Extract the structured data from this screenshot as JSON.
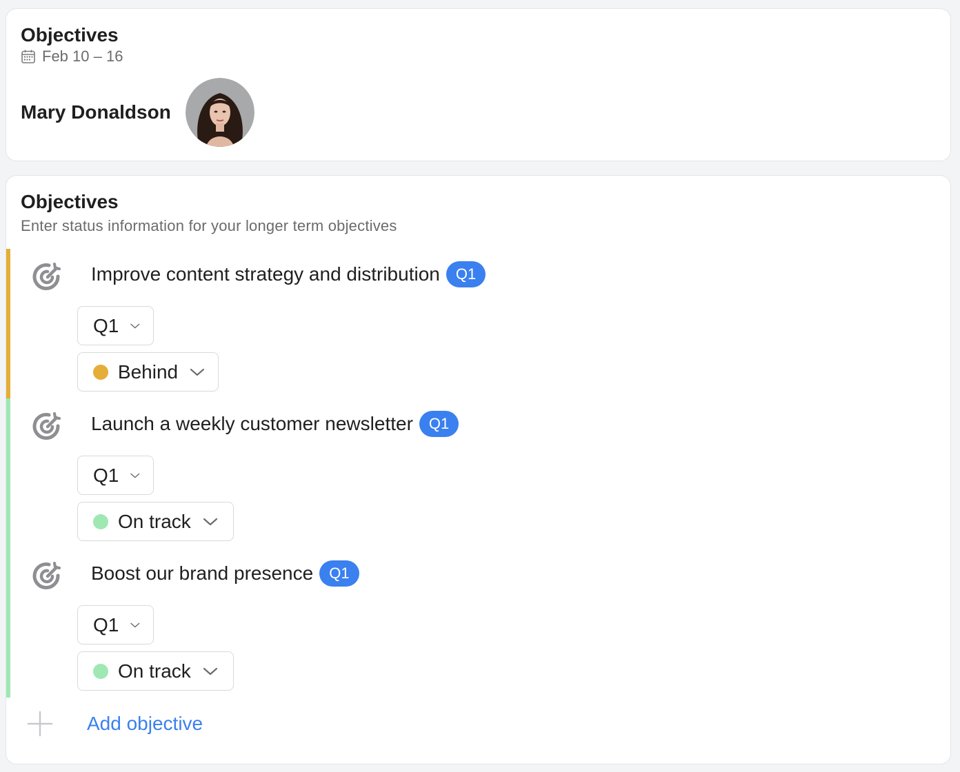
{
  "header": {
    "title": "Objectives",
    "date_range": "Feb 10 – 16",
    "user_name": "Mary Donaldson"
  },
  "section": {
    "title": "Objectives",
    "subtitle": "Enter status information for your longer term objectives",
    "objectives": [
      {
        "title": "Improve content strategy and distribution",
        "badge": "Q1",
        "quarter": "Q1",
        "status": "Behind",
        "status_color": "#e4ae38"
      },
      {
        "title": "Launch a weekly customer newsletter",
        "badge": "Q1",
        "quarter": "Q1",
        "status": "On track",
        "status_color": "#9fe8b4"
      },
      {
        "title": "Boost our brand presence",
        "badge": "Q1",
        "quarter": "Q1",
        "status": "On track",
        "status_color": "#9fe8b4"
      }
    ],
    "add_label": "Add objective"
  },
  "colors": {
    "accent": "#3a80ef",
    "behind": "#e4ae38",
    "on_track": "#9fe8b4"
  }
}
